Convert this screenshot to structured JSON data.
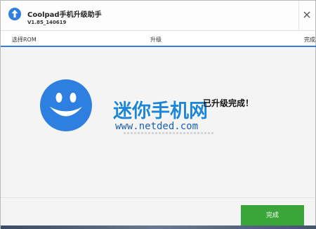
{
  "colors": {
    "accent": "#2f7fe0",
    "success_button": "#3aa63a",
    "smiley": "#2f7fe0",
    "watermark": "#1d86d8"
  },
  "titlebar": {
    "app_icon": "upload-arrow-icon",
    "title": "Coolpad手机升级助手",
    "version": "V1.85_140619",
    "close_icon": "close-icon"
  },
  "steps": [
    {
      "label": "选择ROM"
    },
    {
      "label": "升级"
    },
    {
      "label": "完成"
    }
  ],
  "content": {
    "status_icon": "smiley-face-icon",
    "watermark_text": "迷你手机网",
    "status_text": "已升级完成！",
    "watermark_url": "www.netded.com"
  },
  "footer": {
    "finish_label": "完成"
  }
}
